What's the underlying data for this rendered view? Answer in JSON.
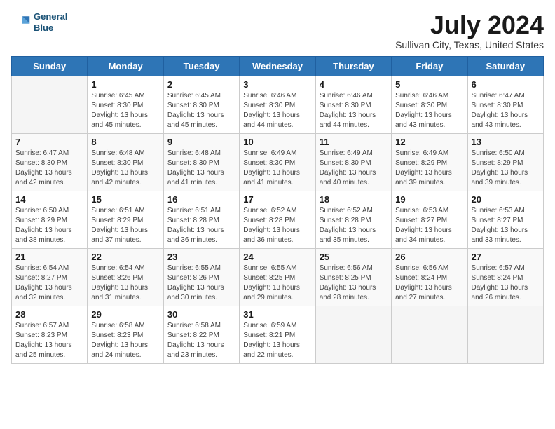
{
  "header": {
    "logo_line1": "General",
    "logo_line2": "Blue",
    "month_year": "July 2024",
    "location": "Sullivan City, Texas, United States"
  },
  "days_of_week": [
    "Sunday",
    "Monday",
    "Tuesday",
    "Wednesday",
    "Thursday",
    "Friday",
    "Saturday"
  ],
  "weeks": [
    [
      {
        "day": "",
        "info": ""
      },
      {
        "day": "1",
        "info": "Sunrise: 6:45 AM\nSunset: 8:30 PM\nDaylight: 13 hours\nand 45 minutes."
      },
      {
        "day": "2",
        "info": "Sunrise: 6:45 AM\nSunset: 8:30 PM\nDaylight: 13 hours\nand 45 minutes."
      },
      {
        "day": "3",
        "info": "Sunrise: 6:46 AM\nSunset: 8:30 PM\nDaylight: 13 hours\nand 44 minutes."
      },
      {
        "day": "4",
        "info": "Sunrise: 6:46 AM\nSunset: 8:30 PM\nDaylight: 13 hours\nand 44 minutes."
      },
      {
        "day": "5",
        "info": "Sunrise: 6:46 AM\nSunset: 8:30 PM\nDaylight: 13 hours\nand 43 minutes."
      },
      {
        "day": "6",
        "info": "Sunrise: 6:47 AM\nSunset: 8:30 PM\nDaylight: 13 hours\nand 43 minutes."
      }
    ],
    [
      {
        "day": "7",
        "info": "Sunrise: 6:47 AM\nSunset: 8:30 PM\nDaylight: 13 hours\nand 42 minutes."
      },
      {
        "day": "8",
        "info": "Sunrise: 6:48 AM\nSunset: 8:30 PM\nDaylight: 13 hours\nand 42 minutes."
      },
      {
        "day": "9",
        "info": "Sunrise: 6:48 AM\nSunset: 8:30 PM\nDaylight: 13 hours\nand 41 minutes."
      },
      {
        "day": "10",
        "info": "Sunrise: 6:49 AM\nSunset: 8:30 PM\nDaylight: 13 hours\nand 41 minutes."
      },
      {
        "day": "11",
        "info": "Sunrise: 6:49 AM\nSunset: 8:30 PM\nDaylight: 13 hours\nand 40 minutes."
      },
      {
        "day": "12",
        "info": "Sunrise: 6:49 AM\nSunset: 8:29 PM\nDaylight: 13 hours\nand 39 minutes."
      },
      {
        "day": "13",
        "info": "Sunrise: 6:50 AM\nSunset: 8:29 PM\nDaylight: 13 hours\nand 39 minutes."
      }
    ],
    [
      {
        "day": "14",
        "info": "Sunrise: 6:50 AM\nSunset: 8:29 PM\nDaylight: 13 hours\nand 38 minutes."
      },
      {
        "day": "15",
        "info": "Sunrise: 6:51 AM\nSunset: 8:29 PM\nDaylight: 13 hours\nand 37 minutes."
      },
      {
        "day": "16",
        "info": "Sunrise: 6:51 AM\nSunset: 8:28 PM\nDaylight: 13 hours\nand 36 minutes."
      },
      {
        "day": "17",
        "info": "Sunrise: 6:52 AM\nSunset: 8:28 PM\nDaylight: 13 hours\nand 36 minutes."
      },
      {
        "day": "18",
        "info": "Sunrise: 6:52 AM\nSunset: 8:28 PM\nDaylight: 13 hours\nand 35 minutes."
      },
      {
        "day": "19",
        "info": "Sunrise: 6:53 AM\nSunset: 8:27 PM\nDaylight: 13 hours\nand 34 minutes."
      },
      {
        "day": "20",
        "info": "Sunrise: 6:53 AM\nSunset: 8:27 PM\nDaylight: 13 hours\nand 33 minutes."
      }
    ],
    [
      {
        "day": "21",
        "info": "Sunrise: 6:54 AM\nSunset: 8:27 PM\nDaylight: 13 hours\nand 32 minutes."
      },
      {
        "day": "22",
        "info": "Sunrise: 6:54 AM\nSunset: 8:26 PM\nDaylight: 13 hours\nand 31 minutes."
      },
      {
        "day": "23",
        "info": "Sunrise: 6:55 AM\nSunset: 8:26 PM\nDaylight: 13 hours\nand 30 minutes."
      },
      {
        "day": "24",
        "info": "Sunrise: 6:55 AM\nSunset: 8:25 PM\nDaylight: 13 hours\nand 29 minutes."
      },
      {
        "day": "25",
        "info": "Sunrise: 6:56 AM\nSunset: 8:25 PM\nDaylight: 13 hours\nand 28 minutes."
      },
      {
        "day": "26",
        "info": "Sunrise: 6:56 AM\nSunset: 8:24 PM\nDaylight: 13 hours\nand 27 minutes."
      },
      {
        "day": "27",
        "info": "Sunrise: 6:57 AM\nSunset: 8:24 PM\nDaylight: 13 hours\nand 26 minutes."
      }
    ],
    [
      {
        "day": "28",
        "info": "Sunrise: 6:57 AM\nSunset: 8:23 PM\nDaylight: 13 hours\nand 25 minutes."
      },
      {
        "day": "29",
        "info": "Sunrise: 6:58 AM\nSunset: 8:23 PM\nDaylight: 13 hours\nand 24 minutes."
      },
      {
        "day": "30",
        "info": "Sunrise: 6:58 AM\nSunset: 8:22 PM\nDaylight: 13 hours\nand 23 minutes."
      },
      {
        "day": "31",
        "info": "Sunrise: 6:59 AM\nSunset: 8:21 PM\nDaylight: 13 hours\nand 22 minutes."
      },
      {
        "day": "",
        "info": ""
      },
      {
        "day": "",
        "info": ""
      },
      {
        "day": "",
        "info": ""
      }
    ]
  ]
}
